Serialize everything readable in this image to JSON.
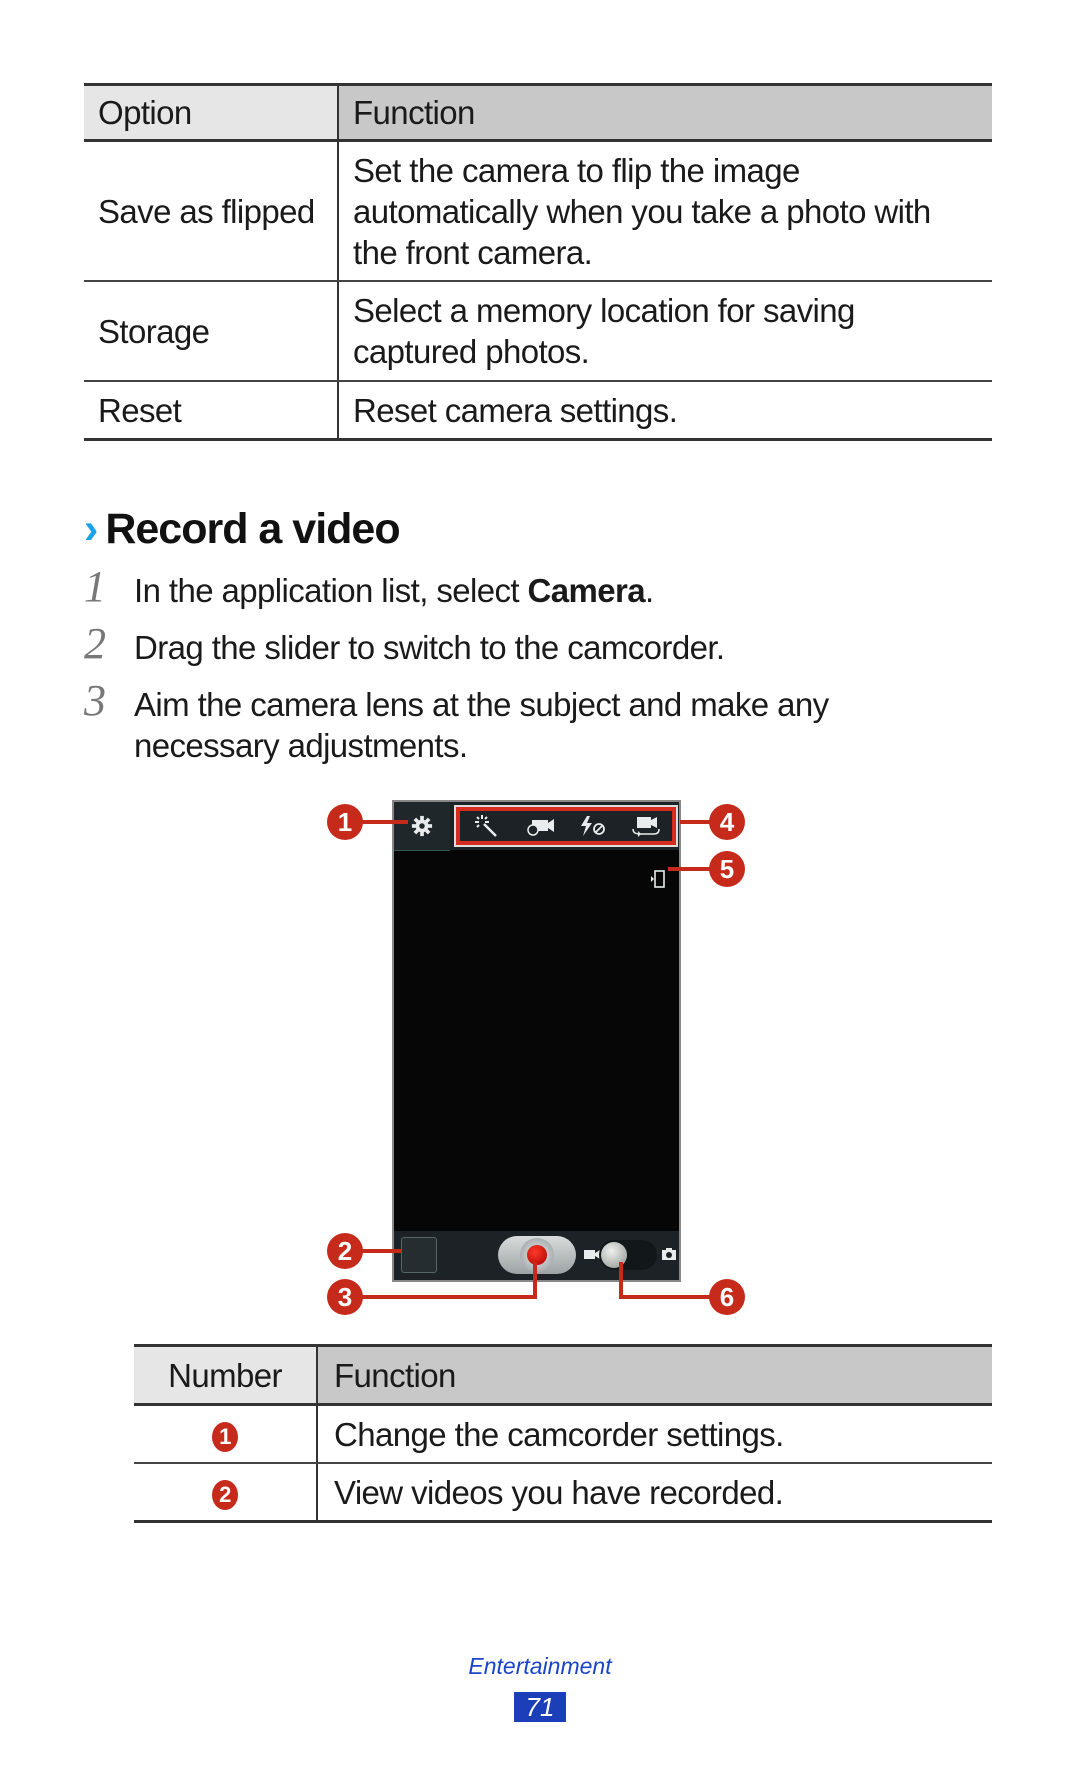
{
  "options_table": {
    "headers": [
      "Option",
      "Function"
    ],
    "rows": [
      {
        "option": "Save as flipped",
        "function": "Set the camera to flip the image automatically when you take a photo with the front camera."
      },
      {
        "option": "Storage",
        "function": "Select a memory location for saving captured photos."
      },
      {
        "option": "Reset",
        "function": "Reset camera settings."
      }
    ]
  },
  "section": {
    "chevron": "›",
    "title": "Record a video"
  },
  "steps": [
    {
      "number": "1",
      "text_before": "In the application list, select ",
      "bold": "Camera",
      "text_after": "."
    },
    {
      "number": "2",
      "text": "Drag the slider to switch to the camcorder."
    },
    {
      "number": "3",
      "text": "Aim the camera lens at the subject and make any necessary adjustments."
    }
  ],
  "camcorder_screen": {
    "top_icons": [
      "settings-gear",
      "effects-wand",
      "recording-mode",
      "flash-off",
      "switch-camera"
    ],
    "indicator": "storage-phone",
    "bottom_controls": [
      "gallery-thumbnail",
      "record-button",
      "mode-switch-video-camera"
    ],
    "callouts": [
      "1",
      "2",
      "3",
      "4",
      "5",
      "6"
    ],
    "colors": {
      "callout": "#c62a1b",
      "highlight": "#d62b1f",
      "record": "#e0140a"
    }
  },
  "number_table": {
    "headers": [
      "Number",
      "Function"
    ],
    "rows": [
      {
        "number": "1",
        "function": "Change the camcorder settings."
      },
      {
        "number": "2",
        "function": "View videos you have recorded."
      }
    ]
  },
  "footer": {
    "section_name": "Entertainment",
    "page_number": "71",
    "color": "#1b45c9"
  }
}
